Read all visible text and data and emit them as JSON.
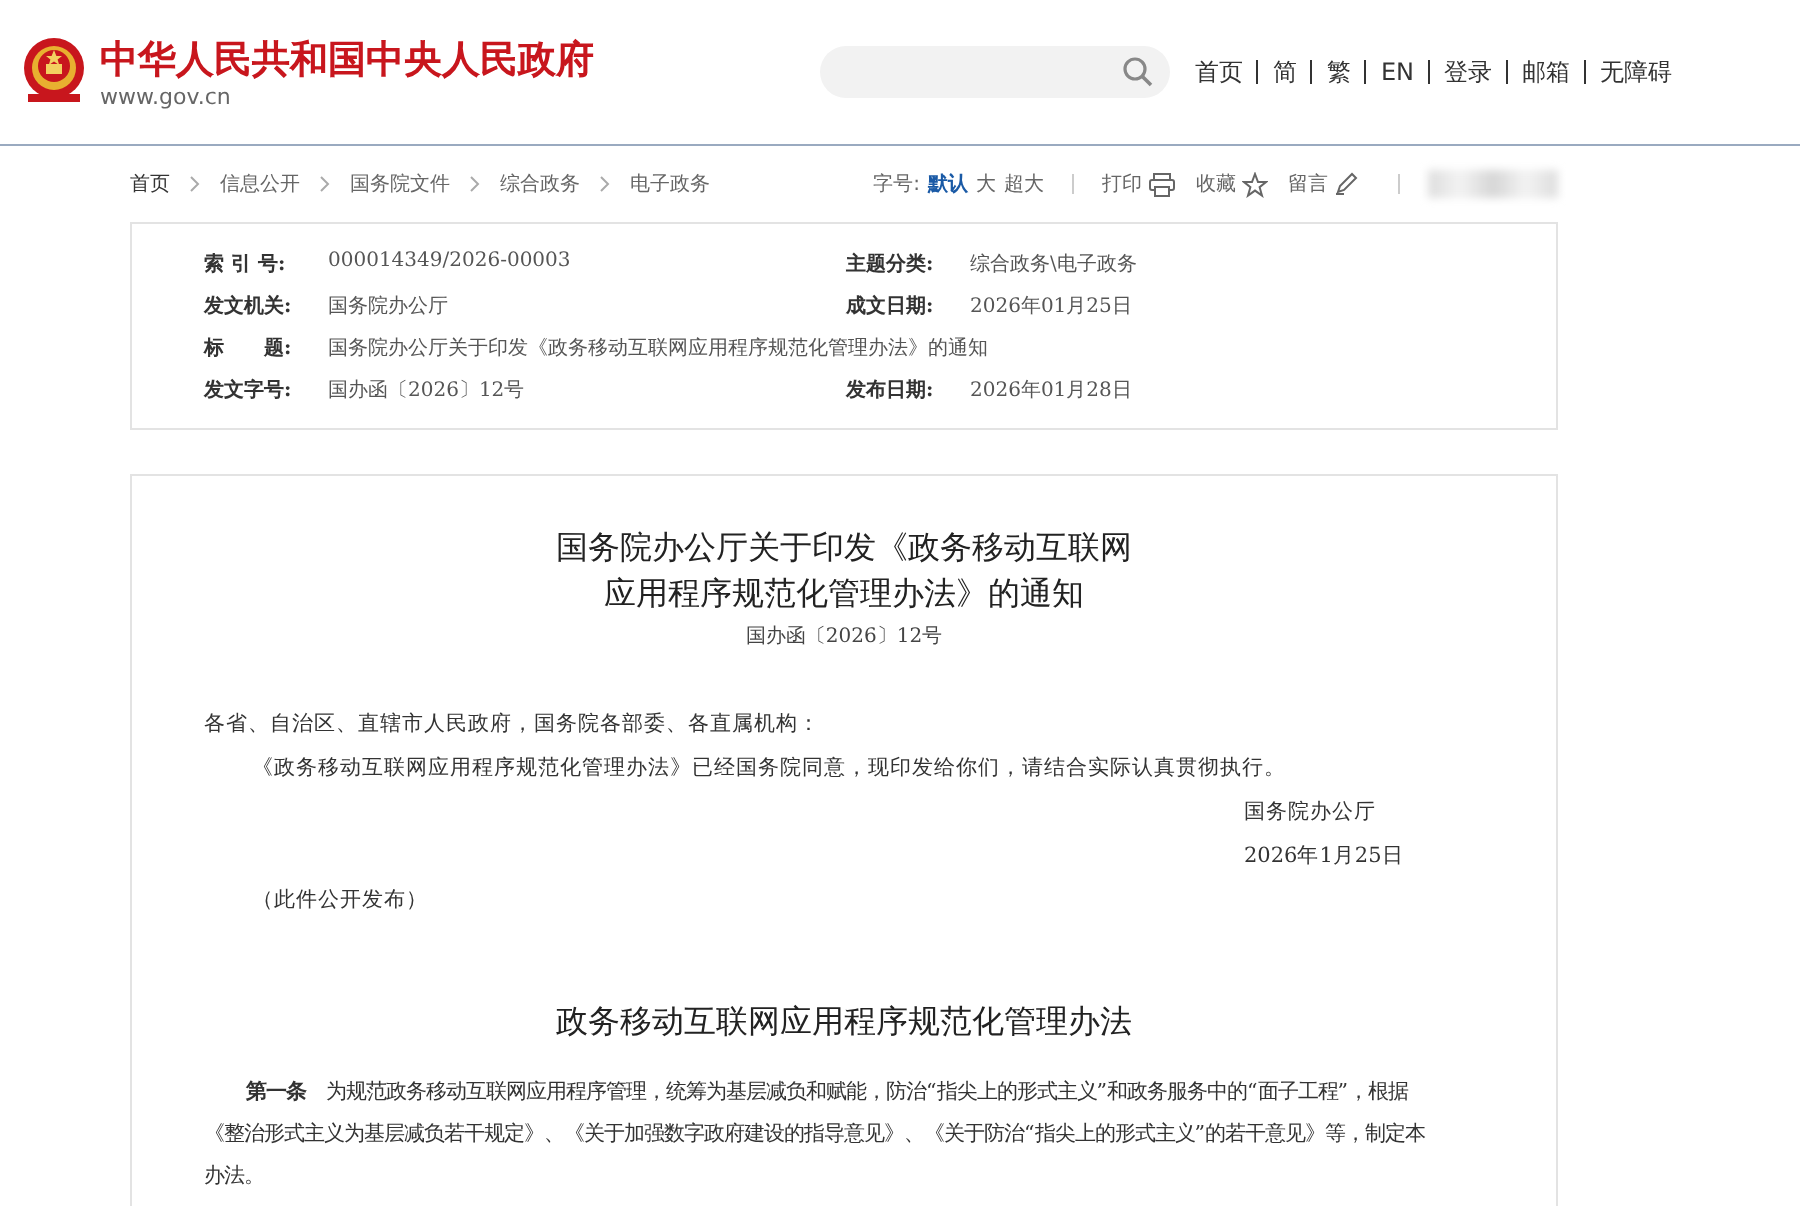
{
  "header": {
    "site_title": "中华人民共和国中央人民政府",
    "site_url": "www.gov.cn",
    "nav_links": [
      "首页",
      "简",
      "繁",
      "EN",
      "登录",
      "邮箱",
      "无障碍"
    ]
  },
  "breadcrumb": [
    "首页",
    "信息公开",
    "国务院文件",
    "综合政务",
    "电子政务"
  ],
  "toolbar": {
    "font_size_label": "字号:",
    "font_sizes": [
      {
        "label": "默认",
        "selected": true
      },
      {
        "label": "大",
        "selected": false
      },
      {
        "label": "超大",
        "selected": false
      }
    ],
    "actions": [
      {
        "label": "打印",
        "kind": "print"
      },
      {
        "label": "收藏",
        "kind": "star"
      },
      {
        "label": "留言",
        "kind": "pencil"
      }
    ]
  },
  "info_table": {
    "rows": [
      [
        {
          "label": "索 引 号:",
          "value": "000014349/2026-00003"
        },
        {
          "label": "主题分类:",
          "value": "综合政务\\电子政务"
        }
      ],
      [
        {
          "label": "发文机关:",
          "value": "国务院办公厅"
        },
        {
          "label": "成文日期:",
          "value": "2026年01月25日"
        }
      ],
      [
        {
          "label": "标　　题:",
          "value": "国务院办公厅关于印发《政务移动互联网应用程序规范化管理办法》的通知"
        }
      ],
      [
        {
          "label": "发文字号:",
          "value": "国办函〔2026〕12号"
        },
        {
          "label": "发布日期:",
          "value": "2026年01月28日"
        }
      ]
    ]
  },
  "article": {
    "title_lines": [
      "国务院办公厅关于印发《政务移动互联网",
      "应用程序规范化管理办法》的通知"
    ],
    "doc_number": "国办函〔2026〕12号",
    "salutation": "各省、自治区、直辖市人民政府，国务院各部委、各直属机构：",
    "body": "《政务移动互联网应用程序规范化管理办法》已经国务院同意，现印发给你们，请结合实际认真贯彻执行。",
    "signature": "国务院办公厅",
    "date": "2026年1月25日",
    "note": "（此件公开发布）",
    "section_title": "政务移动互联网应用程序规范化管理办法",
    "paragraphs": [
      "**第一条**　为规范政务移动互联网应用程序管理，统筹为基层减负和赋能，防治“指尖上的形式主义”和政务服务中的“面子工程”，根据《整治形式主义为基层减负若干规定》、《关于加强数字政府建设的指导意见》、《关于防治“指尖上的形式主义”的若干意见》等，制定本办法。"
    ]
  }
}
